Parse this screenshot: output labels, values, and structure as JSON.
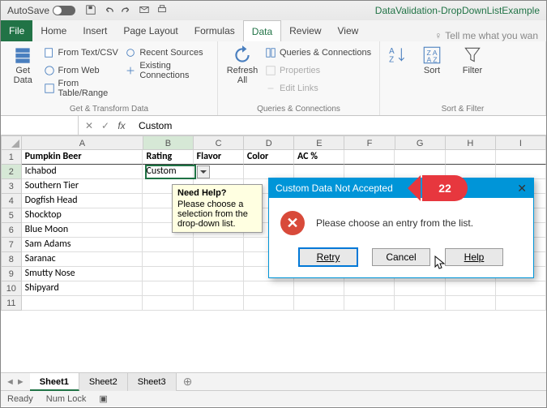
{
  "titlebar": {
    "autosave_label": "AutoSave",
    "autosave_state": "On",
    "doc_title": "DataValidation-DropDownListExample"
  },
  "menu": {
    "file": "File",
    "home": "Home",
    "insert": "Insert",
    "pagelayout": "Page Layout",
    "formulas": "Formulas",
    "data": "Data",
    "review": "Review",
    "view": "View",
    "tellme": "Tell me what you wan"
  },
  "ribbon": {
    "getdata": "Get\nData",
    "from_text": "From Text/CSV",
    "from_web": "From Web",
    "from_table": "From Table/Range",
    "recent": "Recent Sources",
    "existing": "Existing Connections",
    "group1": "Get & Transform Data",
    "refresh": "Refresh\nAll",
    "queries": "Queries & Connections",
    "properties": "Properties",
    "editlinks": "Edit Links",
    "group2": "Queries & Connections",
    "sort": "Sort",
    "filter": "Filter",
    "group3": "Sort & Filter"
  },
  "formulabar": {
    "namebox": "",
    "value": "Custom"
  },
  "columns": [
    "A",
    "B",
    "C",
    "D",
    "E",
    "F",
    "G",
    "H",
    "I"
  ],
  "headers": [
    "Pumpkin Beer",
    "Rating",
    "Flavor",
    "Color",
    "AC %"
  ],
  "rows": [
    {
      "a": "Ichabod",
      "b": "Custom"
    },
    {
      "a": "Southern Tier",
      "b": ""
    },
    {
      "a": "Dogfish Head",
      "b": ""
    },
    {
      "a": "Shocktop",
      "b": ""
    },
    {
      "a": "Blue Moon",
      "b": ""
    },
    {
      "a": "Sam Adams",
      "b": ""
    },
    {
      "a": "Saranac",
      "b": ""
    },
    {
      "a": "Smutty Nose",
      "b": ""
    },
    {
      "a": "Shipyard",
      "b": ""
    },
    {
      "a": "",
      "b": ""
    }
  ],
  "tooltip": {
    "title": "Need Help?",
    "body": "Please choose a selection from the drop-down list."
  },
  "dialog": {
    "title": "Custom Data Not Accepted",
    "message": "Please choose an entry from the list.",
    "retry": "Retry",
    "cancel": "Cancel",
    "help": "Help"
  },
  "annotation": "22",
  "sheets": {
    "s1": "Sheet1",
    "s2": "Sheet2",
    "s3": "Sheet3"
  },
  "status": {
    "ready": "Ready",
    "numlock": "Num Lock"
  }
}
